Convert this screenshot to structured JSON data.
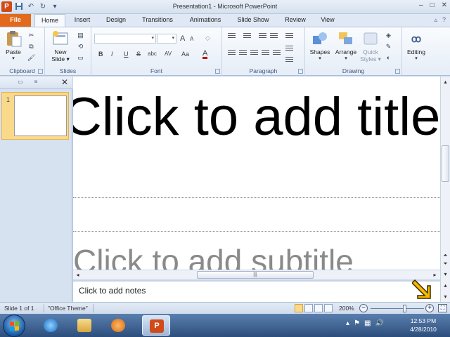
{
  "window": {
    "title": "Presentation1 - Microsoft PowerPoint",
    "controls": [
      "–",
      "□",
      "✕"
    ]
  },
  "tabs": [
    {
      "label": "File"
    },
    {
      "label": "Home"
    },
    {
      "label": "Insert"
    },
    {
      "label": "Design"
    },
    {
      "label": "Transitions"
    },
    {
      "label": "Animations"
    },
    {
      "label": "Slide Show"
    },
    {
      "label": "Review"
    },
    {
      "label": "View"
    }
  ],
  "active_tab": "Home",
  "ribbon": {
    "clipboard": {
      "label": "Clipboard",
      "paste": "Paste"
    },
    "slides": {
      "label": "Slides",
      "new_slide_1": "New",
      "new_slide_2": "Slide ▾"
    },
    "font": {
      "label": "Font",
      "bold": "B",
      "italic": "I",
      "underline": "U",
      "strike": "S",
      "shadow": "abc",
      "spacing": "AV",
      "case": "Aa",
      "grow": "A",
      "shrink": "A",
      "color": "A"
    },
    "paragraph": {
      "label": "Paragraph"
    },
    "drawing": {
      "label": "Drawing",
      "shapes": "Shapes",
      "arrange": "Arrange",
      "quick_styles_1": "Quick",
      "quick_styles_2": "Styles ▾"
    },
    "editing": {
      "label": "Editing"
    }
  },
  "slides_panel": {
    "thumbnail_number": "1"
  },
  "slide": {
    "title_placeholder": "Click to add title",
    "subtitle_placeholder": "Click to add subtitle"
  },
  "notes": {
    "placeholder": "Click to add notes"
  },
  "statusbar": {
    "slide_info": "Slide 1 of 1",
    "theme": "\"Office Theme\"",
    "zoom": "200%",
    "zoom_level_percent": 200
  },
  "taskbar": {
    "time": "12:53 PM",
    "date": "4/28/2010"
  },
  "colors": {
    "file_tab": "#e3691d",
    "selected_thumbnail": "#fbd98a",
    "cursor": "#f5b800"
  }
}
